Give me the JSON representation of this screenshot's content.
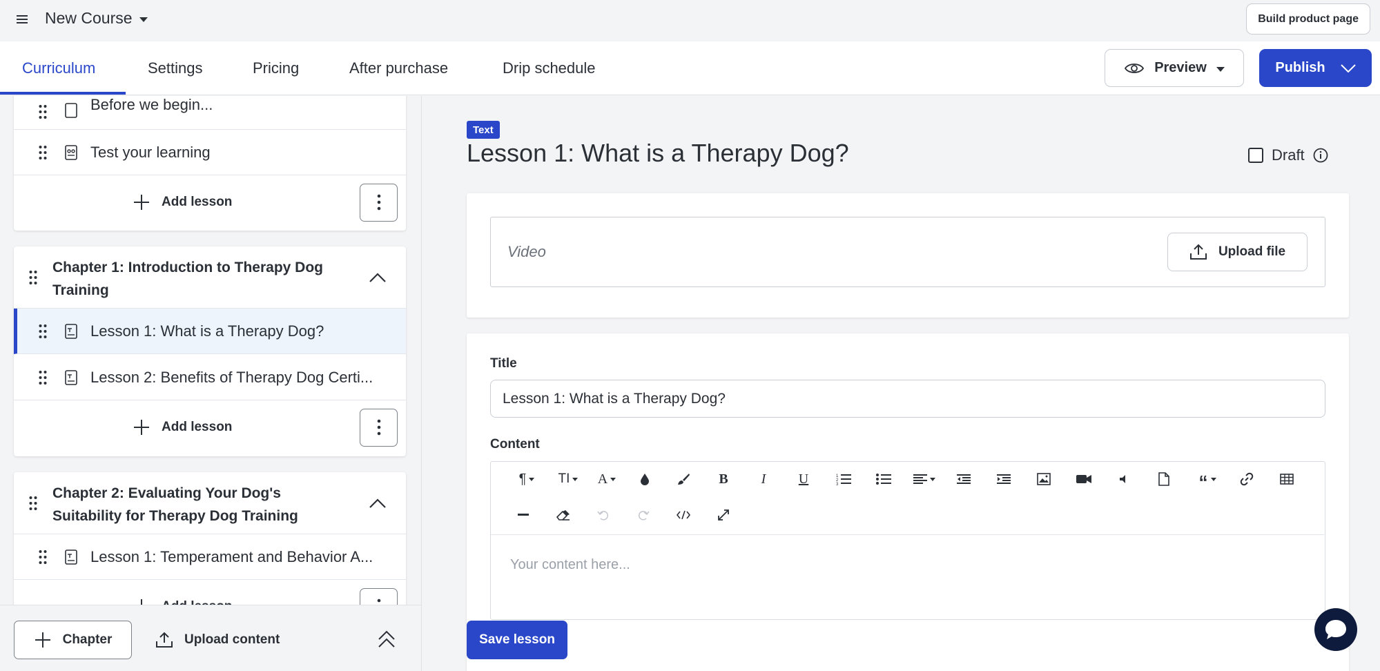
{
  "topbar": {
    "course_title": "New Course",
    "build_product_page": "Build product page"
  },
  "tabs": [
    {
      "label": "Curriculum",
      "active": true
    },
    {
      "label": "Settings",
      "active": false
    },
    {
      "label": "Pricing",
      "active": false
    },
    {
      "label": "After purchase",
      "active": false
    },
    {
      "label": "Drip schedule",
      "active": false
    }
  ],
  "actions": {
    "preview_label": "Preview",
    "publish_label": "Publish"
  },
  "sidebar": {
    "intro_section": {
      "lessons": [
        {
          "label": "Before we begin...",
          "icon": "text-lesson-icon"
        },
        {
          "label": "Test your learning",
          "icon": "quiz-icon"
        }
      ],
      "add_lesson": "Add lesson"
    },
    "chapters": [
      {
        "title": "Chapter 1: Introduction to Therapy Dog Training",
        "lessons": [
          {
            "label": "Lesson 1: What is a Therapy Dog?",
            "active": true
          },
          {
            "label": "Lesson 2: Benefits of Therapy Dog Certi...",
            "active": false
          }
        ],
        "add_lesson": "Add lesson"
      },
      {
        "title": "Chapter 2: Evaluating Your Dog's Suitability for Therapy Dog Training",
        "lessons": [
          {
            "label": "Lesson 1: Temperament and Behavior A...",
            "active": false
          }
        ],
        "add_lesson": "Add lesson"
      }
    ],
    "footer": {
      "chapter_label": "Chapter",
      "upload_content_label": "Upload content"
    }
  },
  "main": {
    "type_badge": "Text",
    "lesson_heading": "Lesson 1: What is a Therapy Dog?",
    "draft_label": "Draft",
    "video": {
      "label": "Video",
      "upload_file_label": "Upload file"
    },
    "form": {
      "title_label": "Title",
      "title_value": "Lesson 1: What is a Therapy Dog?",
      "content_label": "Content",
      "content_placeholder": "Your content here..."
    },
    "save_label": "Save lesson"
  },
  "colors": {
    "accent": "#2a47c9",
    "active_row_bg": "#eef4fc",
    "chat_bubble": "#0f1b3d"
  }
}
